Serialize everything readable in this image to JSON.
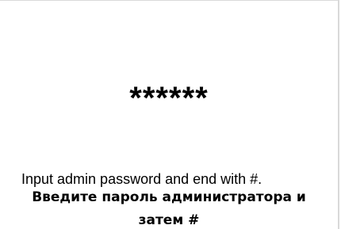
{
  "screen": {
    "password_mask": "******",
    "prompt_en": "Input admin password and end with #.",
    "prompt_ru_line1": "Введите пароль администратора и",
    "prompt_ru_line2": "затем #"
  }
}
